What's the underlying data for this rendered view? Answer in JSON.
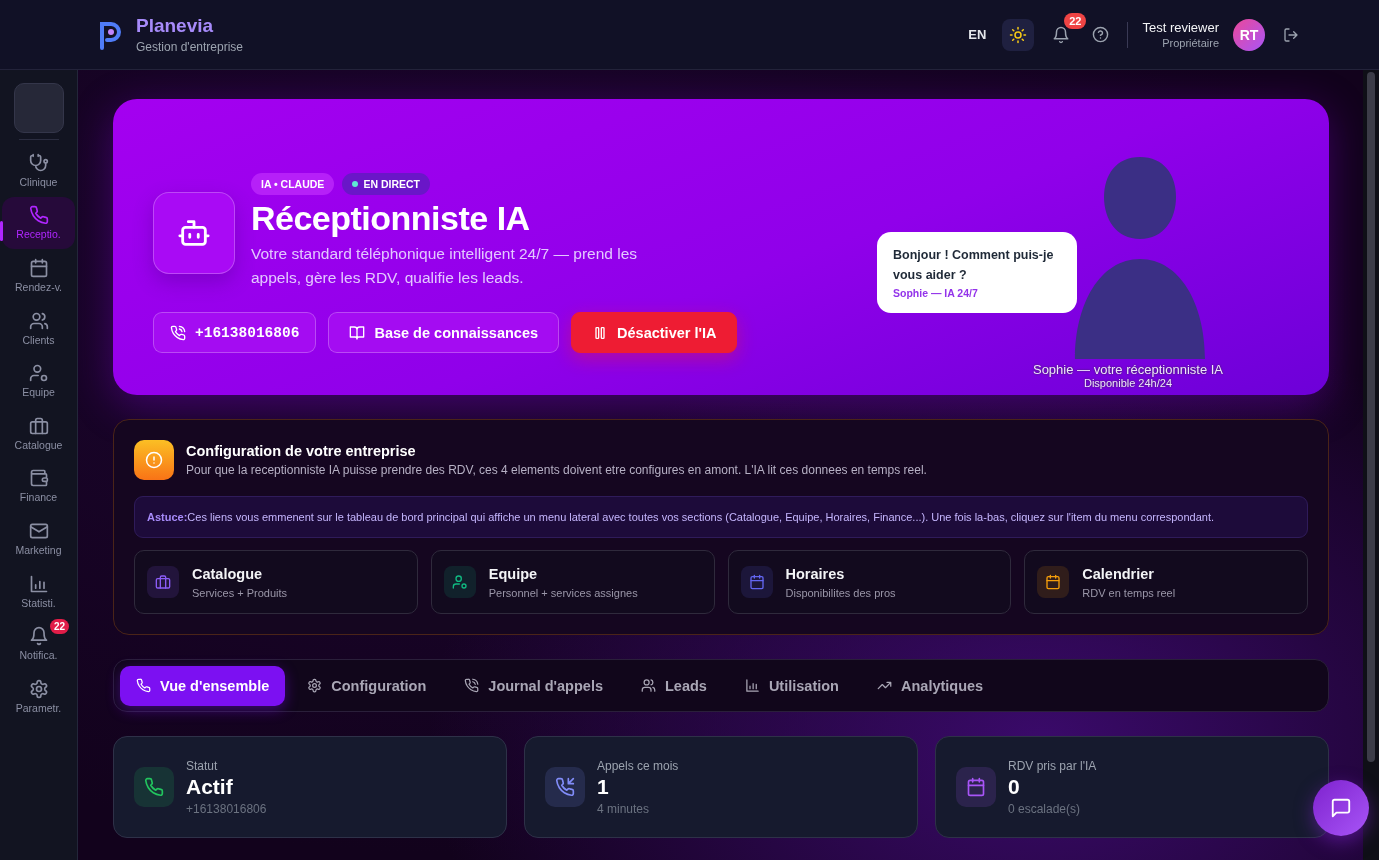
{
  "header": {
    "brand": "Planevia",
    "tagline": "Gestion d'entreprise",
    "language": "EN",
    "notifications": "22",
    "user_name": "Test reviewer",
    "user_role": "Propriétaire",
    "avatar_initials": "RT"
  },
  "sidebar": {
    "items": [
      {
        "label": "Clinique",
        "selected": false
      },
      {
        "label": "Receptio.",
        "selected": true
      },
      {
        "label": "Rendez-v.",
        "selected": false
      },
      {
        "label": "Clients",
        "selected": false
      },
      {
        "label": "Equipe",
        "selected": false
      },
      {
        "label": "Catalogue",
        "selected": false
      },
      {
        "label": "Finance",
        "selected": false
      },
      {
        "label": "Marketing",
        "selected": false
      },
      {
        "label": "Statisti.",
        "selected": false
      },
      {
        "label": "Notifica.",
        "selected": false,
        "badge": "22"
      },
      {
        "label": "Parametr.",
        "selected": false
      }
    ]
  },
  "hero": {
    "badges": [
      {
        "label": "IA • CLAUDE",
        "kind": "tag"
      },
      {
        "label": "EN DIRECT",
        "kind": "live"
      }
    ],
    "title": "Réceptionniste IA",
    "subtitle": "Votre standard téléphonique intelligent 24/7 — prend les appels, gère les RDV, qualifie les leads.",
    "buttons": [
      {
        "label": "+16138016806",
        "kind": "phone"
      },
      {
        "label": "Base de connaissances",
        "kind": "outline"
      },
      {
        "label": "Désactiver l'IA",
        "kind": "danger"
      }
    ],
    "bubble": {
      "message": "Bonjour ! Comment puis-je vous aider ?",
      "signature": "Sophie — IA 24/7"
    },
    "caption": "Sophie — votre réceptionniste IA",
    "availability": "Disponible 24h/24"
  },
  "setup": {
    "title": "Configuration de votre entreprise",
    "description": "Pour que la receptionniste IA puisse prendre des RDV, ces 4 elements doivent etre configures en amont. L'IA lit ces donnees en temps reel.",
    "tip": "**Astuce:**Ces liens vous emmenent sur le tableau de bord principal qui affiche un menu lateral avec toutes vos sections (Catalogue, Equipe, Horaires, Finance...). Une fois la-bas, cliquez sur l'item du menu correspondant.",
    "links": [
      {
        "title": "Catalogue",
        "subtitle": "Services + Produits",
        "color": "#8b5cf6"
      },
      {
        "title": "Equipe",
        "subtitle": "Personnel + services assignes",
        "color": "#10b981"
      },
      {
        "title": "Horaires",
        "subtitle": "Disponibilites des pros",
        "color": "#6366f1"
      },
      {
        "title": "Calendrier",
        "subtitle": "RDV en temps reel",
        "color": "#f59e0b"
      }
    ]
  },
  "tabs": [
    {
      "label": "Vue d'ensemble",
      "selected": true
    },
    {
      "label": "Configuration",
      "selected": false
    },
    {
      "label": "Journal d'appels",
      "selected": false
    },
    {
      "label": "Leads",
      "selected": false
    },
    {
      "label": "Utilisation",
      "selected": false
    },
    {
      "label": "Analytiques",
      "selected": false
    }
  ],
  "stats": [
    {
      "label": "Statut",
      "value": "Actif",
      "detail": "+16138016806",
      "color": "#22c55e"
    },
    {
      "label": "Appels ce mois",
      "value": "1",
      "detail": "4 minutes",
      "color": "#818cf8"
    },
    {
      "label": "RDV pris par l'IA",
      "value": "0",
      "detail": "0 escalade(s)",
      "color": "#a855f7"
    }
  ]
}
